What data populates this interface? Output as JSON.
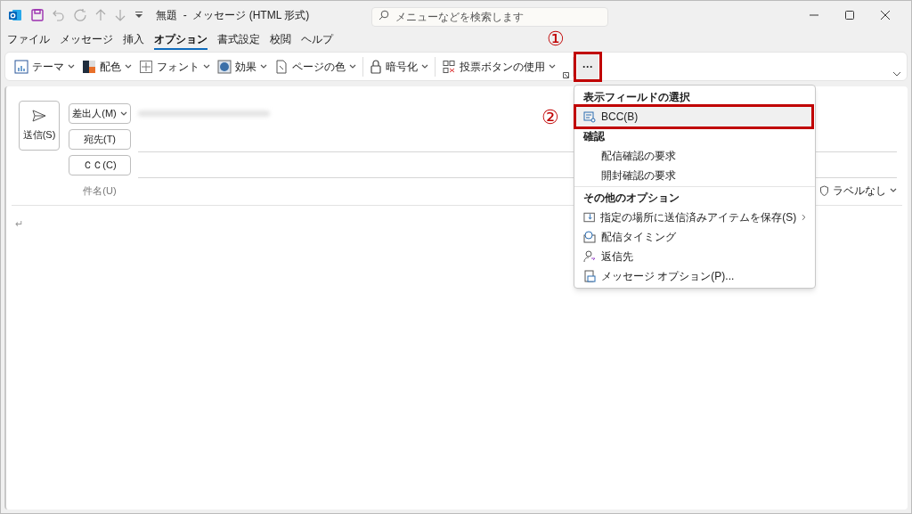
{
  "title_bar": {
    "title": "無題  -  メッセージ (HTML 形式)",
    "search_placeholder": "メニューなどを検索します"
  },
  "tabs": [
    {
      "label": "ファイル",
      "selected": false
    },
    {
      "label": "メッセージ",
      "selected": false
    },
    {
      "label": "挿入",
      "selected": false
    },
    {
      "label": "オプション",
      "selected": true
    },
    {
      "label": "書式設定",
      "selected": false
    },
    {
      "label": "校閲",
      "selected": false
    },
    {
      "label": "ヘルプ",
      "selected": false
    }
  ],
  "ribbon": {
    "groups": [
      [
        "テーマ",
        "配色",
        "フォント",
        "効果",
        "ページの色"
      ],
      [
        "暗号化"
      ],
      [
        "投票ボタンの使用"
      ]
    ],
    "more_button": {
      "label": "···",
      "callout": "①"
    }
  },
  "menu": {
    "items": [
      {
        "kind": "heading",
        "label": "表示フィールドの選択"
      },
      {
        "kind": "item",
        "label": "BCC(B)",
        "highlighted": true,
        "callout": "②"
      },
      {
        "kind": "heading",
        "label": "確認"
      },
      {
        "kind": "item",
        "label": "配信確認の要求",
        "highlighted": false
      },
      {
        "kind": "item",
        "label": "開封確認の要求",
        "highlighted": false
      },
      {
        "kind": "heading",
        "label": "その他のオプション"
      },
      {
        "kind": "item",
        "label": "指定の場所に送信済みアイテムを保存(S)",
        "highlighted": false,
        "submenu": true
      },
      {
        "kind": "item",
        "label": "配信タイミング",
        "highlighted": false
      },
      {
        "kind": "item",
        "label": "返信先",
        "highlighted": false
      },
      {
        "kind": "item",
        "label": "メッセージ オプション(P)...",
        "highlighted": false
      }
    ]
  },
  "compose": {
    "send_button": "送信(S)",
    "from_button": "差出人(M)",
    "to_button": "宛先(T)",
    "cc_button": "ＣＣ(C)",
    "subject_label": "件名(U)",
    "sensitivity": "ラベルなし",
    "body_mark": "↵"
  }
}
